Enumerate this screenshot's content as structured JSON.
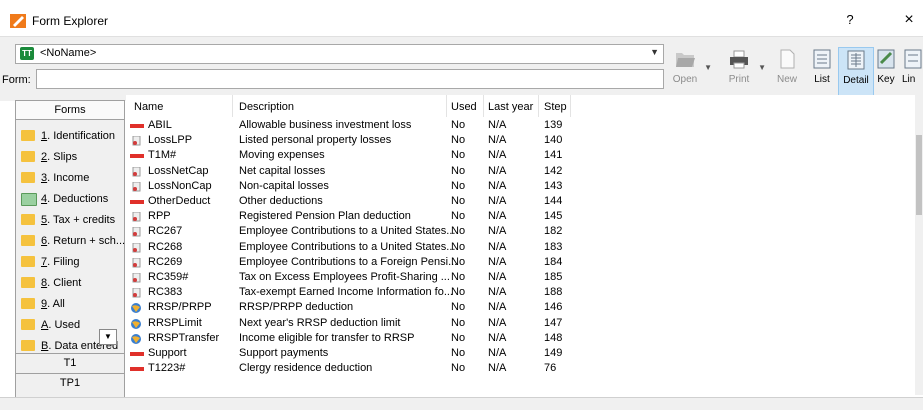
{
  "window": {
    "title": "Form Explorer",
    "help": "?",
    "close": "×"
  },
  "toolbar": {
    "file_select": "<NoName>",
    "file_badge": "TT",
    "form_label": "Form:",
    "form_value": "",
    "buttons": [
      {
        "label": "Open",
        "icon": "open-icon",
        "disabled": true
      },
      {
        "label": "Print",
        "icon": "print-icon",
        "disabled": true
      },
      {
        "label": "New",
        "icon": "new-icon",
        "disabled": true
      },
      {
        "label": "List",
        "icon": "list-icon",
        "disabled": false
      },
      {
        "label": "Detail",
        "icon": "detail-icon",
        "disabled": false,
        "active": true
      },
      {
        "label": "Key",
        "icon": "key-icon",
        "disabled": false
      },
      {
        "label": "Lin",
        "icon": "line-icon",
        "disabled": false
      }
    ]
  },
  "sidebar": {
    "header": "Forms",
    "folders": [
      {
        "key": "1",
        "rest": ". Identification"
      },
      {
        "key": "2",
        "rest": ". Slips"
      },
      {
        "key": "3",
        "rest": ". Income"
      },
      {
        "key": "4",
        "rest": ". Deductions",
        "selected": true
      },
      {
        "key": "5",
        "rest": ". Tax + credits"
      },
      {
        "key": "6",
        "rest": ". Return + sch..."
      },
      {
        "key": "7",
        "rest": ". Filing"
      },
      {
        "key": "8",
        "rest": ". Client"
      },
      {
        "key": "9",
        "rest": ". All"
      },
      {
        "key": "A",
        "rest": ". Used"
      },
      {
        "key": "B",
        "rest": ". Data entered"
      }
    ],
    "sections": [
      "T1",
      "TP1"
    ]
  },
  "table": {
    "columns": [
      "Name",
      "Description",
      "Used",
      "Last year",
      "Step"
    ],
    "rows": [
      {
        "icon": "red-dash",
        "name": "ABIL",
        "desc": "Allowable business investment loss",
        "used": "No",
        "last": "N/A",
        "step": "139"
      },
      {
        "icon": "doc",
        "name": "LossLPP",
        "desc": "Listed personal property losses",
        "used": "No",
        "last": "N/A",
        "step": "140"
      },
      {
        "icon": "red-dash",
        "name": "T1M#",
        "desc": "Moving expenses",
        "used": "No",
        "last": "N/A",
        "step": "141"
      },
      {
        "icon": "doc",
        "name": "LossNetCap",
        "desc": "Net capital losses",
        "used": "No",
        "last": "N/A",
        "step": "142"
      },
      {
        "icon": "doc",
        "name": "LossNonCap",
        "desc": "Non-capital losses",
        "used": "No",
        "last": "N/A",
        "step": "143"
      },
      {
        "icon": "red-dash",
        "name": "OtherDeduct",
        "desc": "Other deductions",
        "used": "No",
        "last": "N/A",
        "step": "144"
      },
      {
        "icon": "doc",
        "name": "RPP",
        "desc": "Registered Pension Plan deduction",
        "used": "No",
        "last": "N/A",
        "step": "145"
      },
      {
        "icon": "doc",
        "name": "RC267",
        "desc": "Employee Contributions to a United States...",
        "used": "No",
        "last": "N/A",
        "step": "182"
      },
      {
        "icon": "doc",
        "name": "RC268",
        "desc": "Employee Contributions to a United States...",
        "used": "No",
        "last": "N/A",
        "step": "183"
      },
      {
        "icon": "doc",
        "name": "RC269",
        "desc": "Employee Contributions to a Foreign Pensi...",
        "used": "No",
        "last": "N/A",
        "step": "184"
      },
      {
        "icon": "doc",
        "name": "RC359#",
        "desc": "Tax on Excess Employees Profit-Sharing ...",
        "used": "No",
        "last": "N/A",
        "step": "185"
      },
      {
        "icon": "doc",
        "name": "RC383",
        "desc": "Tax-exempt Earned Income Information fo...",
        "used": "No",
        "last": "N/A",
        "step": "188"
      },
      {
        "icon": "globe",
        "name": "RRSP/PRPP",
        "desc": "RRSP/PRPP deduction",
        "used": "No",
        "last": "N/A",
        "step": "146"
      },
      {
        "icon": "globe",
        "name": "RRSPLimit",
        "desc": "Next year's RRSP deduction limit",
        "used": "No",
        "last": "N/A",
        "step": "147"
      },
      {
        "icon": "globe",
        "name": "RRSPTransfer",
        "desc": "Income eligible for transfer to RRSP",
        "used": "No",
        "last": "N/A",
        "step": "148"
      },
      {
        "icon": "red-dash",
        "name": "Support",
        "desc": "Support payments",
        "used": "No",
        "last": "N/A",
        "step": "149"
      },
      {
        "icon": "red-dash",
        "name": "T1223#",
        "desc": "Clergy residence deduction",
        "used": "No",
        "last": "N/A",
        "step": "76"
      }
    ]
  },
  "colors": {
    "folder": "#f5c23e",
    "active_button": "#cce4f7",
    "red_dash": "#e0302a",
    "badge": "#1a8a3a"
  }
}
